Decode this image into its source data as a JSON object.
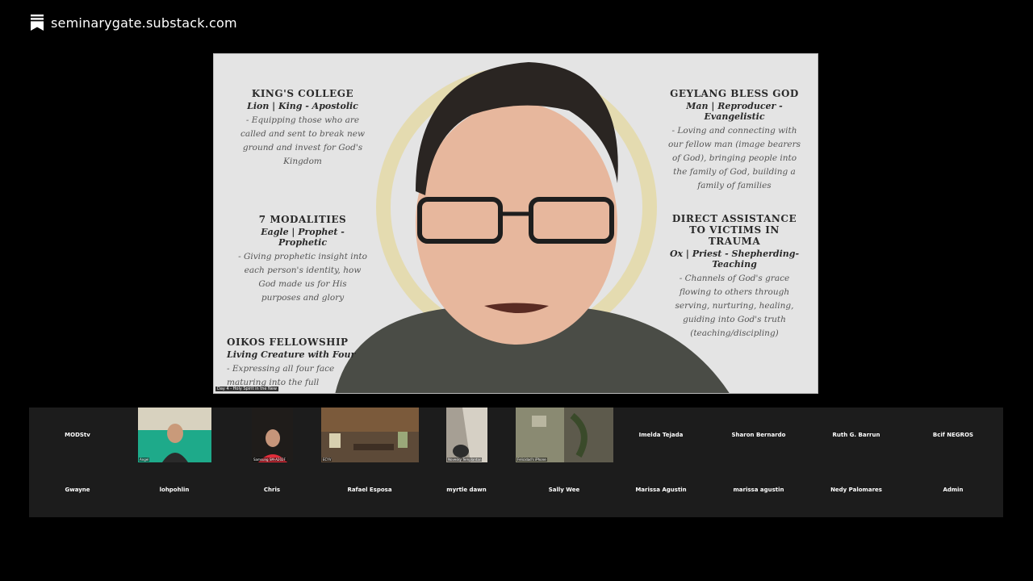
{
  "header": {
    "site": "seminarygate.substack.com",
    "icon": "substack-bookmark-icon"
  },
  "slide": {
    "blocks": [
      {
        "title": "KING'S COLLEGE",
        "sub": "Lion | King - Apostolic",
        "desc": "- Equipping those who are called and sent to break new ground and invest for God's Kingdom"
      },
      {
        "title": "7 MODALITIES",
        "sub": "Eagle | Prophet - Prophetic",
        "desc": "- Giving prophetic insight into each person's identity, how God made us for His purposes and glory"
      },
      {
        "title": "OIKOS FELLOWSHIP",
        "sub": "Living Creature with Four",
        "desc": "- Expressing all four face maturing into the full"
      },
      {
        "title": "GEYLANG BLESS GOD",
        "sub": "Man | Reproducer - Evangelistic",
        "desc": "- Loving and connecting with our fellow man (image bearers of God), bringing people into the family of God, building a family of families"
      },
      {
        "title": "DIRECT ASSISTANCE TO VICTIMS IN TRAUMA",
        "sub": "Ox | Priest - Shepherding-Teaching",
        "desc": "- Channels of God's grace flowing to others through serving, nurturing, healing, guiding into God's truth (teaching/discipling)"
      }
    ],
    "caption": "Day 4 - Holy Spirit in the New"
  },
  "gallery": {
    "row1": [
      {
        "name": "MODStv",
        "video": false
      },
      {
        "name": "Angel",
        "video": true
      },
      {
        "name": "Samsung SM-A202F",
        "video": true
      },
      {
        "name": "ECYV",
        "video": true
      },
      {
        "name": "Novesky Templantan",
        "video": true
      },
      {
        "name": "Felicidad's iPhone",
        "video": true
      },
      {
        "name": "Imelda Tejada",
        "video": false
      },
      {
        "name": "Sharon Bernardo",
        "video": false
      },
      {
        "name": "Ruth G. Barrun",
        "video": false
      },
      {
        "name": "Bcif NEGROS",
        "video": false
      }
    ],
    "row2": [
      {
        "name": "Gwayne"
      },
      {
        "name": "lohpohlin"
      },
      {
        "name": "Chris"
      },
      {
        "name": "Rafael Esposa"
      },
      {
        "name": "myrtle dawn"
      },
      {
        "name": "Sally Wee"
      },
      {
        "name": "Marissa Agustin"
      },
      {
        "name": "marissa agustin"
      },
      {
        "name": "Nedy Palomares"
      },
      {
        "name": "Admin"
      }
    ]
  }
}
